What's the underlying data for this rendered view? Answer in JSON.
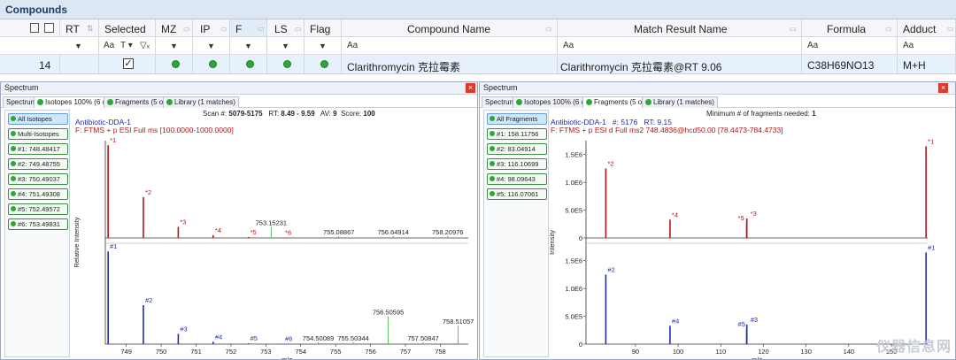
{
  "window": {
    "title": "Compounds"
  },
  "grid": {
    "headers": {
      "rt": "RT",
      "selected": "Selected",
      "mz": "MZ",
      "ip": "IP",
      "f": "F",
      "ls": "LS",
      "flag": "Flag",
      "compound_name": "Compound Name",
      "match_result_name": "Match Result Name",
      "formula": "Formula",
      "adduct": "Adduct"
    },
    "filter_text_glyph": "Aa",
    "row": {
      "rt": "14",
      "compound_name": "Clarithromycin 克拉霉素",
      "match_result_name": "Clarithromycin 克拉霉素@RT 9.06",
      "formula": "C38H69NO13",
      "adduct": "M+H"
    }
  },
  "left_panel": {
    "title": "Spectrum",
    "tabs": [
      "Spectrum",
      "Isotopes 100% (6 of 6)",
      "Fragments (5 of 5)",
      "Library (1 matches)"
    ],
    "list": [
      "All Isotopes",
      "Multi-Isotopes",
      "#1: 748.48417",
      "#2: 749.48755",
      "#3: 750.49037",
      "#4: 751.49308",
      "#5: 752.49572",
      "#6: 753.49831"
    ],
    "meta": {
      "scan_label": "Scan #:",
      "scan": "5079-5175",
      "rt_label": "RT:",
      "rt": "8.49 - 9.59",
      "av_label": "AV:",
      "av": "9",
      "score_label": "Score:",
      "score": "100",
      "sample": "Antibiotic-DDA-1",
      "filter": "F: FTMS + p ESI Full ms [100.0000-1000.0000]"
    }
  },
  "right_panel": {
    "title": "Spectrum",
    "tabs": [
      "Spectrum",
      "Isotopes 100% (6 of 6)",
      "Fragments (5 of 5)",
      "Library (1 matches)"
    ],
    "list": [
      "All Fragments",
      "#1: 158.11756",
      "#2: 83.04914",
      "#3: 116.10699",
      "#4: 98.09643",
      "#5: 116.07061"
    ],
    "meta": {
      "min_label": "Minimum # of fragments needed:",
      "min": "1",
      "sample": "Antibiotic-DDA-1",
      "scan_label": "#:",
      "scan": "5176",
      "rt_label": "RT:",
      "rt": "9.15",
      "filter": "F: FTMS + p ESI d Full ms2 748.4836@hcd50.00 [78.4473-784.4733]"
    }
  },
  "watermark": "仪器信息网",
  "colors": {
    "accent_green": "#2fa63a",
    "spectrum_red": "#b01818",
    "spectrum_blue": "#1d2fa8",
    "ref_green": "#3cb043"
  },
  "chart_data": [
    {
      "type": "bar",
      "name_hint": "isotope-mirror-plot",
      "xlabel": "m/z",
      "ylabel": "Relative Intensity",
      "xlim": [
        748.4,
        758.8
      ],
      "x_ticks": [
        749,
        750,
        751,
        752,
        753,
        754,
        755,
        756,
        757,
        758
      ],
      "series": [
        {
          "name": "measured",
          "color": "#b01818",
          "points": [
            {
              "x": 748.48,
              "y": 100,
              "label": "*1"
            },
            {
              "x": 749.49,
              "y": 44,
              "label": "*2"
            },
            {
              "x": 750.49,
              "y": 12,
              "label": "*3"
            },
            {
              "x": 751.49,
              "y": 3,
              "label": "*4"
            },
            {
              "x": 752.5,
              "y": 1,
              "label": "*5"
            },
            {
              "x": 753.5,
              "y": 0.5,
              "label": "*6"
            }
          ]
        },
        {
          "name": "theoretical",
          "color": "#1d2fa8",
          "points": [
            {
              "x": 748.48,
              "y": 100,
              "label": "#1"
            },
            {
              "x": 749.49,
              "y": 42,
              "label": "#2"
            },
            {
              "x": 750.49,
              "y": 11,
              "label": "#3"
            },
            {
              "x": 751.49,
              "y": 2.5,
              "label": "#4"
            },
            {
              "x": 752.5,
              "y": 0.8,
              "label": "#5"
            },
            {
              "x": 753.5,
              "y": 0.4,
              "label": "#6"
            }
          ]
        }
      ],
      "annotations_top": [
        {
          "x": 753.15231,
          "text": "753.15231",
          "y": 12
        },
        {
          "x": 755.08867,
          "text": "755.08867",
          "y": 2
        },
        {
          "x": 756.64914,
          "text": "756.64914",
          "y": 2
        },
        {
          "x": 758.20976,
          "text": "758.20976",
          "y": 2
        }
      ],
      "annotations_bottom": [
        {
          "x": 754.50089,
          "text": "754.50089",
          "y": 2
        },
        {
          "x": 755.50344,
          "text": "755.50344",
          "y": 2
        },
        {
          "x": 756.50595,
          "text": "756.50595",
          "y": 30
        },
        {
          "x": 757.50847,
          "text": "757.50847",
          "y": 2
        },
        {
          "x": 758.51057,
          "text": "758.51057",
          "y": 20
        }
      ]
    },
    {
      "type": "bar",
      "name_hint": "fragment-mirror-plot",
      "xlabel": "m/z",
      "ylabel": "Intensity",
      "xlim": [
        78.4,
        158.5
      ],
      "ylim": [
        0,
        1750000
      ],
      "y_ticks": [
        "0",
        "5.0E5",
        "1.0E6",
        "1.5E6"
      ],
      "x_ticks": [
        90,
        100,
        110,
        120,
        130,
        140,
        150
      ],
      "series": [
        {
          "name": "measured",
          "color": "#b01818",
          "points": [
            {
              "x": 83.04914,
              "y": 1250000,
              "label": "*2"
            },
            {
              "x": 98.09643,
              "y": 330000,
              "label": "*4"
            },
            {
              "x": 116.07061,
              "y": 270000,
              "label": "*5"
            },
            {
              "x": 116.10699,
              "y": 350000,
              "label": "*3"
            },
            {
              "x": 158.11756,
              "y": 1650000,
              "label": "*1"
            }
          ]
        },
        {
          "name": "library",
          "color": "#1d2fa8",
          "points": [
            {
              "x": 83.04914,
              "y": 1250000,
              "label": "#2"
            },
            {
              "x": 98.09643,
              "y": 330000,
              "label": "#4"
            },
            {
              "x": 116.07061,
              "y": 270000,
              "label": "#5"
            },
            {
              "x": 116.10699,
              "y": 350000,
              "label": "#3"
            },
            {
              "x": 158.11756,
              "y": 1650000,
              "label": "#1"
            }
          ]
        }
      ]
    }
  ]
}
